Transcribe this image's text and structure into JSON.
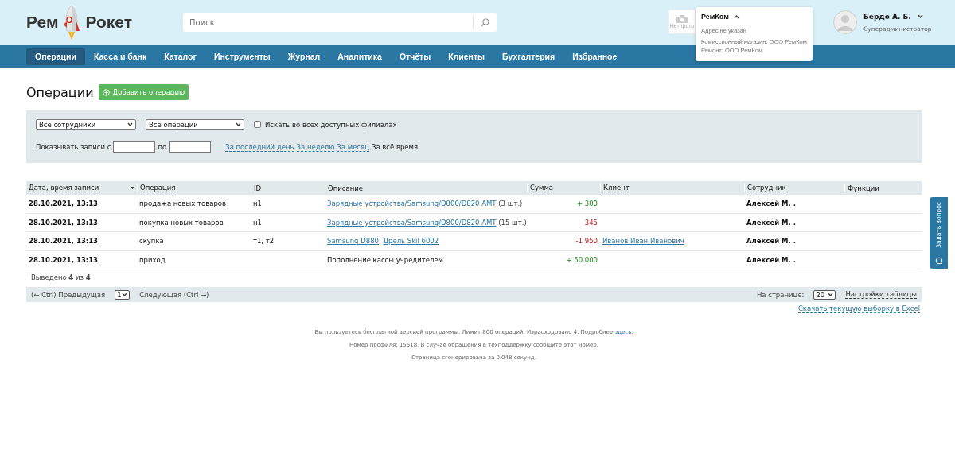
{
  "logo": {
    "left": "Рем",
    "right": "Рокет"
  },
  "search": {
    "placeholder": "Поиск"
  },
  "company": {
    "photo_label": "Нет фото",
    "name": "РемКом",
    "expanded": true,
    "address": "Адрес не указан",
    "lines": [
      "Комиссионный магазин: ООО РемКом",
      "Ремонт: ООО РемКом"
    ]
  },
  "user": {
    "name": "Бердо А. Б.",
    "role": "Суперадминистратор"
  },
  "nav": [
    {
      "label": "Операции",
      "selected": true
    },
    {
      "label": "Касса и банк",
      "selected": false
    },
    {
      "label": "Каталог",
      "selected": false
    },
    {
      "label": "Инструменты",
      "selected": false
    },
    {
      "label": "Журнал",
      "selected": false
    },
    {
      "label": "Аналитика",
      "selected": false
    },
    {
      "label": "Отчёты",
      "selected": false
    },
    {
      "label": "Клиенты",
      "selected": false
    },
    {
      "label": "Бухгалтерия",
      "selected": false
    },
    {
      "label": "Избранное",
      "selected": false
    }
  ],
  "page_title": "Операции",
  "add_button": "Добавить операцию",
  "filters": {
    "employees": "Все сотрудники",
    "operations": "Все операции",
    "all_branches": {
      "label": "Искать во всех доступных филиалах",
      "checked": false
    },
    "range_label": "Показывать записи с",
    "range_to": "по",
    "periods": [
      {
        "label": "За последний день",
        "selected": false
      },
      {
        "label": "За неделю",
        "selected": false
      },
      {
        "label": "За месяц",
        "selected": false
      },
      {
        "label": "За всё время",
        "selected": true
      }
    ]
  },
  "table": {
    "columns": [
      {
        "label": "Дата, время записи",
        "sortable": true,
        "sorted": true
      },
      {
        "label": "Операция",
        "sortable": true,
        "sorted": false
      },
      {
        "label": "ID",
        "sortable": false,
        "sorted": false
      },
      {
        "label": "Описание",
        "sortable": false,
        "sorted": false
      },
      {
        "label": "Сумма",
        "sortable": true,
        "sorted": false
      },
      {
        "label": "Клиент",
        "sortable": true,
        "sorted": false
      },
      {
        "label": "Сотрудник",
        "sortable": true,
        "sorted": false
      },
      {
        "label": "Функции",
        "sortable": false,
        "sorted": false
      }
    ],
    "rows": [
      {
        "date": "28.10.2021, 13:13",
        "operation": "продажа новых товаров",
        "id": "н1",
        "description": [
          {
            "text": "Зарядные устройства/Samsung/D800/D820 AMT",
            "link": true
          },
          {
            "text": " (3 шт.)",
            "link": false
          }
        ],
        "sum": "+ 300",
        "kind": "positive",
        "client": "",
        "employee": "Алексей М. ."
      },
      {
        "date": "28.10.2021, 13:13",
        "operation": "покупка новых товаров",
        "id": "н1",
        "description": [
          {
            "text": "Зарядные устройства/Samsung/D800/D820 AMT",
            "link": true
          },
          {
            "text": " (15 шт.)",
            "link": false
          }
        ],
        "sum": "-345",
        "kind": "negative",
        "client": "",
        "employee": "Алексей М. ."
      },
      {
        "date": "28.10.2021, 13:13",
        "operation": "скупка",
        "id": "т1, т2",
        "description": [
          {
            "text": "Samsung D880",
            "link": true
          },
          {
            "text": ", ",
            "link": false
          },
          {
            "text": "Дрель Skil 6002",
            "link": true
          }
        ],
        "sum": "-1 950",
        "kind": "negative",
        "client": "Иванов Иван Иванович",
        "employee": "Алексей М. ."
      },
      {
        "date": "28.10.2021, 13:13",
        "operation": "приход",
        "id": "",
        "description": [
          {
            "text": "Пополнение кассы учредителем",
            "link": false
          }
        ],
        "sum": "+ 50 000",
        "kind": "positive",
        "client": "",
        "employee": "Алексей М. ."
      }
    ],
    "shown": "Выведено **4** из **4**"
  },
  "pager": {
    "prev": "(← Ctrl) Предыдущая",
    "page": "1",
    "next": "Следующая (Ctrl →)",
    "per_page_label": "На странице:",
    "per_page": "20",
    "settings": "Настройки таблицы"
  },
  "excel_link": "Скачать текущую выборку в Excel",
  "footer": [
    {
      "text": "Вы пользуетесь бесплатной версией программы. Лимит 800 операций. Израсходовано 4. Подробнее ",
      "link": "здесь",
      "after": "."
    },
    {
      "text": "Номер профиля: 15518. В случае обращения в техподдержку сообщите этот номер."
    },
    {
      "text": "Страница сгенерирована за 0.048 секунд."
    }
  ],
  "side_tab": "Задать вопрос"
}
